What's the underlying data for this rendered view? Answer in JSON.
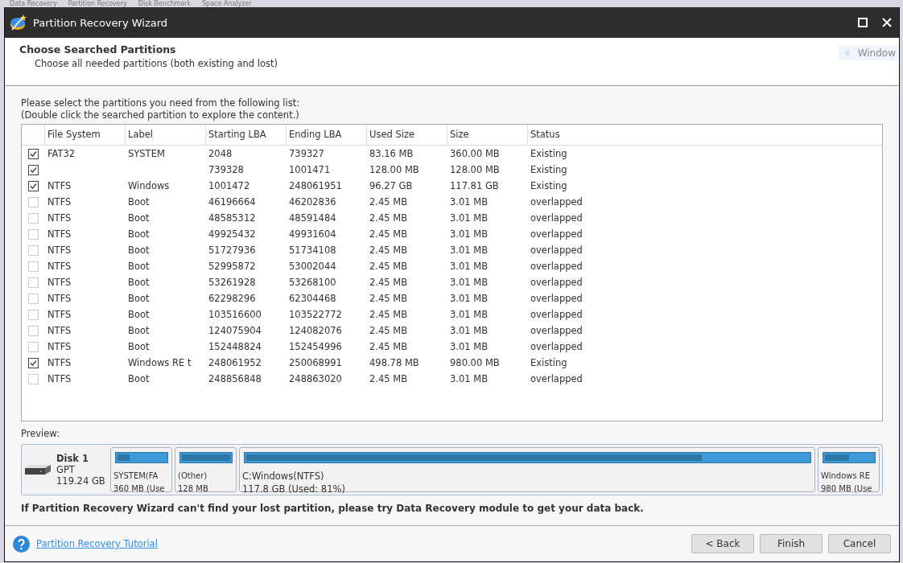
{
  "background_menu": [
    "Data Recovery",
    "Partition Recovery",
    "Disk Benchmark",
    "Space Analyzer"
  ],
  "window": {
    "title": "Partition Recovery Wizard"
  },
  "header": {
    "title": "Choose Searched Partitions",
    "subtitle": "Choose all needed partitions (both existing and lost)",
    "background_tab": "Window"
  },
  "instructions": [
    "Please select the partitions you need from the following list:",
    "(Double click the searched partition to explore the content.)"
  ],
  "table": {
    "columns": [
      "File System",
      "Label",
      "Starting LBA",
      "Ending LBA",
      "Used Size",
      "Size",
      "Status"
    ],
    "rows": [
      {
        "checked": true,
        "cells": [
          "FAT32",
          "SYSTEM",
          "2048",
          "739327",
          "83.16 MB",
          "360.00 MB",
          "Existing"
        ]
      },
      {
        "checked": true,
        "cells": [
          "",
          "",
          "739328",
          "1001471",
          "128.00 MB",
          "128.00 MB",
          "Existing"
        ]
      },
      {
        "checked": true,
        "cells": [
          "NTFS",
          "Windows",
          "1001472",
          "248061951",
          "96.27 GB",
          "117.81 GB",
          "Existing"
        ]
      },
      {
        "checked": false,
        "cells": [
          "NTFS",
          "Boot",
          "46196664",
          "46202836",
          "2.45 MB",
          "3.01 MB",
          "overlapped"
        ]
      },
      {
        "checked": false,
        "cells": [
          "NTFS",
          "Boot",
          "48585312",
          "48591484",
          "2.45 MB",
          "3.01 MB",
          "overlapped"
        ]
      },
      {
        "checked": false,
        "cells": [
          "NTFS",
          "Boot",
          "49925432",
          "49931604",
          "2.45 MB",
          "3.01 MB",
          "overlapped"
        ]
      },
      {
        "checked": false,
        "cells": [
          "NTFS",
          "Boot",
          "51727936",
          "51734108",
          "2.45 MB",
          "3.01 MB",
          "overlapped"
        ]
      },
      {
        "checked": false,
        "cells": [
          "NTFS",
          "Boot",
          "52995872",
          "53002044",
          "2.45 MB",
          "3.01 MB",
          "overlapped"
        ]
      },
      {
        "checked": false,
        "cells": [
          "NTFS",
          "Boot",
          "53261928",
          "53268100",
          "2.45 MB",
          "3.01 MB",
          "overlapped"
        ]
      },
      {
        "checked": false,
        "cells": [
          "NTFS",
          "Boot",
          "62298296",
          "62304468",
          "2.45 MB",
          "3.01 MB",
          "overlapped"
        ]
      },
      {
        "checked": false,
        "cells": [
          "NTFS",
          "Boot",
          "103516600",
          "103522772",
          "2.45 MB",
          "3.01 MB",
          "overlapped"
        ]
      },
      {
        "checked": false,
        "cells": [
          "NTFS",
          "Boot",
          "124075904",
          "124082076",
          "2.45 MB",
          "3.01 MB",
          "overlapped"
        ]
      },
      {
        "checked": false,
        "cells": [
          "NTFS",
          "Boot",
          "152448824",
          "152454996",
          "2.45 MB",
          "3.01 MB",
          "overlapped"
        ]
      },
      {
        "checked": true,
        "cells": [
          "NTFS",
          "Windows RE t",
          "248061952",
          "250068991",
          "498.78 MB",
          "980.00 MB",
          "Existing"
        ]
      },
      {
        "checked": false,
        "cells": [
          "NTFS",
          "Boot",
          "248856848",
          "248863020",
          "2.45 MB",
          "3.01 MB",
          "overlapped"
        ]
      }
    ]
  },
  "preview": {
    "label": "Preview:",
    "disk": {
      "name": "Disk 1",
      "type": "GPT",
      "size": "119.24 GB"
    },
    "partitions": [
      {
        "name": "SYSTEM(FA",
        "detail": "360 MB (Use",
        "level": 0.25,
        "wide": false
      },
      {
        "name": "(Other)",
        "detail": "128 MB",
        "level": 1.0,
        "wide": false
      },
      {
        "name": "C:Windows(NTFS)",
        "detail": "117.8 GB (Used: 81%)",
        "level": 0.81,
        "wide": true
      },
      {
        "name": "Windows RE",
        "detail": "980 MB (Use",
        "level": 0.5,
        "wide": false
      }
    ]
  },
  "note": "If Partition Recovery Wizard can't find your lost partition, please try Data Recovery module to get your data back.",
  "footer": {
    "link": "Partition Recovery Tutorial",
    "buttons": [
      "< Back",
      "Finish",
      "Cancel"
    ]
  }
}
